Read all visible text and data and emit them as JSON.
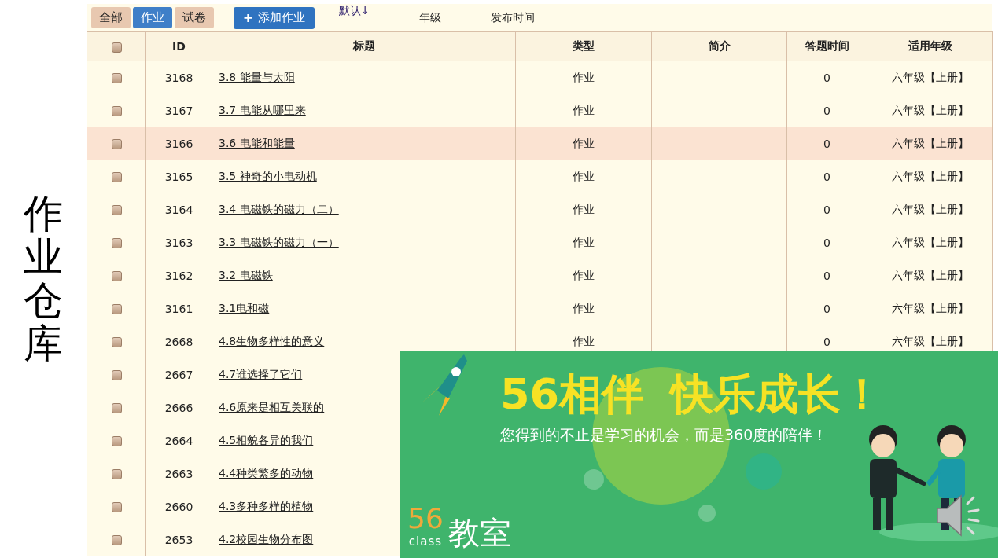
{
  "side_title": "作业仓库",
  "toolbar": {
    "tabs": [
      {
        "label": "全部",
        "selected": false
      },
      {
        "label": "作业",
        "selected": true
      },
      {
        "label": "试卷",
        "selected": false
      }
    ],
    "add_button": {
      "icon": "+",
      "label": "添加作业"
    },
    "sort_links": [
      "默认↓",
      "年级",
      "发布时间"
    ]
  },
  "table": {
    "header_checkbox": {
      "checked": false
    },
    "columns": [
      "ID",
      "标题",
      "类型",
      "简介",
      "答题时间",
      "适用年级"
    ],
    "rows": [
      {
        "checked": false,
        "selected": false,
        "id": "3168",
        "title": "3.8 能量与太阳",
        "type": "作业",
        "time": "0",
        "grade": "六年级【上册】"
      },
      {
        "checked": false,
        "selected": false,
        "id": "3167",
        "title": "3.7 电能从哪里来",
        "type": "作业",
        "time": "0",
        "grade": "六年级【上册】"
      },
      {
        "checked": false,
        "selected": true,
        "id": "3166",
        "title": "3.6 电能和能量",
        "type": "作业",
        "time": "0",
        "grade": "六年级【上册】"
      },
      {
        "checked": false,
        "selected": false,
        "id": "3165",
        "title": "3.5 神奇的小电动机",
        "type": "作业",
        "time": "0",
        "grade": "六年级【上册】"
      },
      {
        "checked": false,
        "selected": false,
        "id": "3164",
        "title": "3.4 电磁铁的磁力（二）",
        "type": "作业",
        "time": "0",
        "grade": "六年级【上册】"
      },
      {
        "checked": false,
        "selected": false,
        "id": "3163",
        "title": "3.3 电磁铁的磁力（一）",
        "type": "作业",
        "time": "0",
        "grade": "六年级【上册】"
      },
      {
        "checked": false,
        "selected": false,
        "id": "3162",
        "title": "3.2 电磁铁",
        "type": "作业",
        "time": "0",
        "grade": "六年级【上册】"
      },
      {
        "checked": false,
        "selected": false,
        "id": "3161",
        "title": "3.1电和磁",
        "type": "作业",
        "time": "0",
        "grade": "六年级【上册】"
      },
      {
        "checked": false,
        "selected": false,
        "id": "2668",
        "title": "4.8生物多样性的意义",
        "type": "作业",
        "time": "0",
        "grade": "六年级【上册】"
      },
      {
        "checked": false,
        "selected": false,
        "id": "2667",
        "title": "4.7谁选择了它们"
      },
      {
        "checked": false,
        "selected": false,
        "id": "2666",
        "title": "4.6原来是相互关联的"
      },
      {
        "checked": false,
        "selected": false,
        "id": "2664",
        "title": "4.5相貌各异的我们"
      },
      {
        "checked": false,
        "selected": false,
        "id": "2663",
        "title": "4.4种类繁多的动物"
      },
      {
        "checked": false,
        "selected": false,
        "id": "2660",
        "title": "4.3多种多样的植物"
      },
      {
        "checked": false,
        "selected": false,
        "id": "2653",
        "title": "4.2校园生物分布图"
      }
    ]
  },
  "banner": {
    "headline": [
      "56相伴",
      "快乐成长！"
    ],
    "tagline": "您得到的不止是学习的机会，而是360度的陪伴！",
    "logo": {
      "mark": "56",
      "sub": "class",
      "name": "教室"
    }
  }
}
